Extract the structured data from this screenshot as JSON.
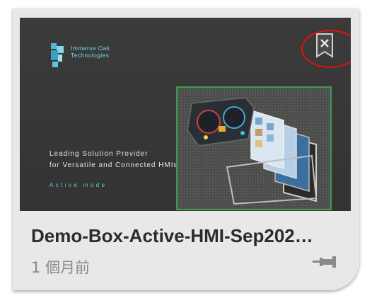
{
  "card": {
    "title": "Demo-Box-Active-HMI-Sep202…",
    "timestamp": "1 個月前",
    "bookmark_icon": "bookmark-remove-icon",
    "pin_icon": "pushpin-icon"
  },
  "thumbnail": {
    "logo_line1": "Immerse Oak",
    "logo_line2": "Technologies",
    "tagline_line1": "Leading Solution Provider",
    "tagline_line2": "for Versatile and Connected HMIs.",
    "mode_text": "Active mode"
  },
  "colors": {
    "card_bg": "#e8e8e8",
    "thumb_bg": "#363636",
    "accent_cyan": "#5fc9de",
    "highlight_ring": "#e01010",
    "frame_green": "#3f9b4f"
  }
}
